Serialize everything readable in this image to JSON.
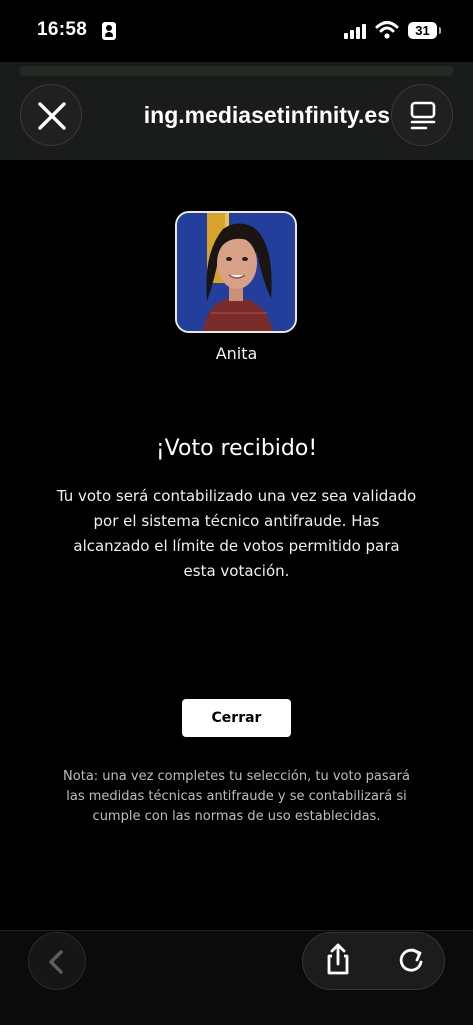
{
  "status_bar": {
    "time": "16:58",
    "battery": "31"
  },
  "browser": {
    "url": "ing.mediasetinfinity.es"
  },
  "vote": {
    "candidate_name": "Anita",
    "title": "¡Voto recibido!",
    "message": "Tu voto será contabilizado una vez sea validado por el sistema técnico antifraude. Has alcanzado el límite de votos permitido para esta votación.",
    "close_label": "Cerrar",
    "footnote": "Nota: una vez completes tu selección, tu voto pasará las medidas técnicas antifraude y se contabilizará si cumple con las normas de uso establecidas."
  },
  "icons": {
    "status": [
      "contact-card-icon",
      "signal-icon",
      "wifi-icon",
      "battery-icon"
    ],
    "toolbar": [
      "close-icon",
      "tabs-icon",
      "back-icon",
      "share-icon",
      "reload-icon"
    ]
  },
  "colors": {
    "background": "#000000",
    "avatar_background": "#223f9a",
    "button_background": "#ffffff",
    "footnote_text": "#bdbdbd"
  }
}
